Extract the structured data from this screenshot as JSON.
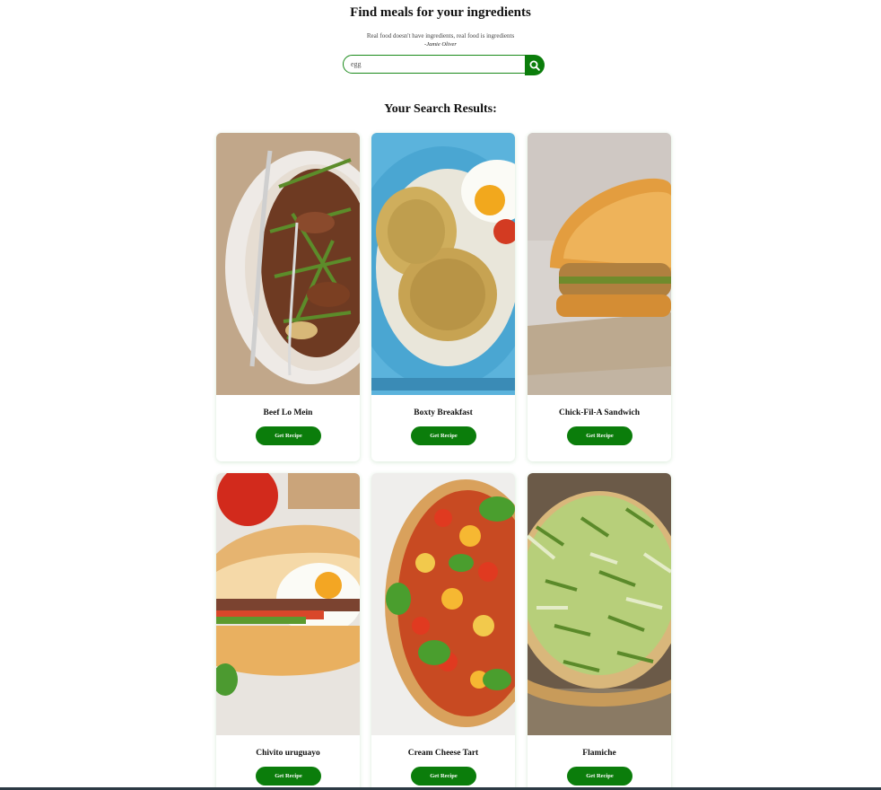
{
  "header": {
    "title": "Find meals for your ingredients",
    "quote": "Real food doesn't have ingredients, real food is ingredients",
    "author": "-Jamie Oliver"
  },
  "search": {
    "value": "egg",
    "button_icon": "search-icon",
    "accent_color": "#0b7d0b"
  },
  "results": {
    "title": "Your Search Results:",
    "button_label": "Get Recipe",
    "meals": [
      {
        "name": "Beef Lo Mein"
      },
      {
        "name": "Boxty Breakfast"
      },
      {
        "name": "Chick-Fil-A Sandwich"
      },
      {
        "name": "Chivito uruguayo"
      },
      {
        "name": "Cream Cheese Tart"
      },
      {
        "name": "Flamiche"
      }
    ]
  }
}
